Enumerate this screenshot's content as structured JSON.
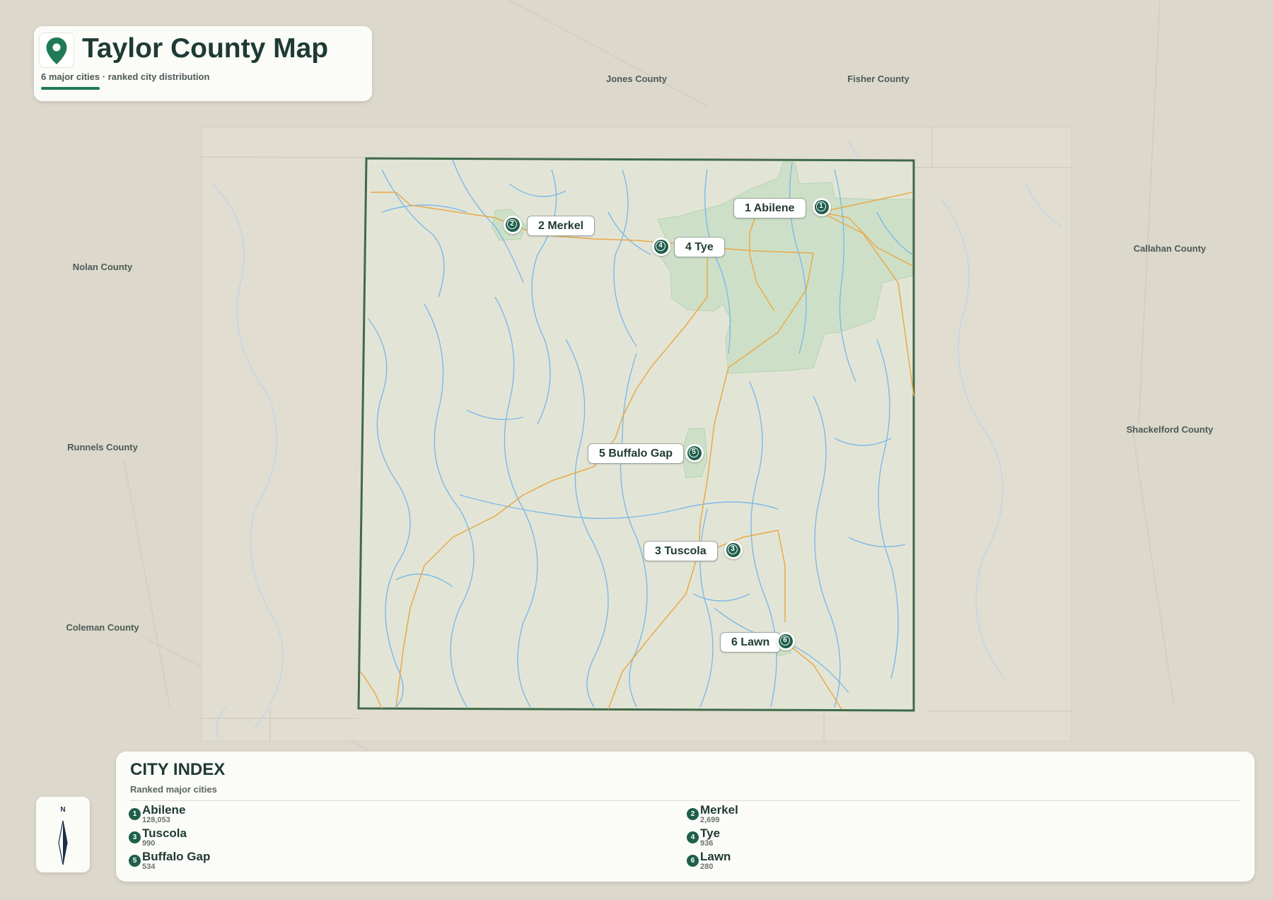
{
  "header": {
    "title": "Taylor County Map",
    "subtitle": "6 major cities · ranked city distribution",
    "pin_icon": "map-pin-icon"
  },
  "neighbors": [
    {
      "name": "Jones County"
    },
    {
      "name": "Fisher County"
    },
    {
      "name": "Nolan County"
    },
    {
      "name": "Callahan County"
    },
    {
      "name": "Runnels County"
    },
    {
      "name": "Shackelford County"
    },
    {
      "name": "Coleman County"
    }
  ],
  "cities": [
    {
      "rank": "1",
      "name": "Abilene",
      "label": "1 Abilene",
      "population": "128,053"
    },
    {
      "rank": "2",
      "name": "Merkel",
      "label": "2 Merkel",
      "population": "2,699"
    },
    {
      "rank": "3",
      "name": "Tuscola",
      "label": "3 Tuscola",
      "population": "990"
    },
    {
      "rank": "4",
      "name": "Tye",
      "label": "4 Tye",
      "population": "936"
    },
    {
      "rank": "5",
      "name": "Buffalo Gap",
      "label": "5 Buffalo Gap",
      "population": "534"
    },
    {
      "rank": "6",
      "name": "Lawn",
      "label": "6 Lawn",
      "population": "280"
    }
  ],
  "legend": {
    "title": "CITY INDEX",
    "subtitle": "Ranked major cities"
  },
  "north_arrow": {
    "letter": "N",
    "icon": "north-arrow-icon"
  },
  "colors": {
    "accent": "#1f5f4c",
    "county_border": "#3f6a47",
    "county_fill": "#e2e5d6",
    "urban_fill": "#cde0c7",
    "river": "#7eb9e6",
    "road": "#e9a84a",
    "background": "#dcd8cc"
  }
}
